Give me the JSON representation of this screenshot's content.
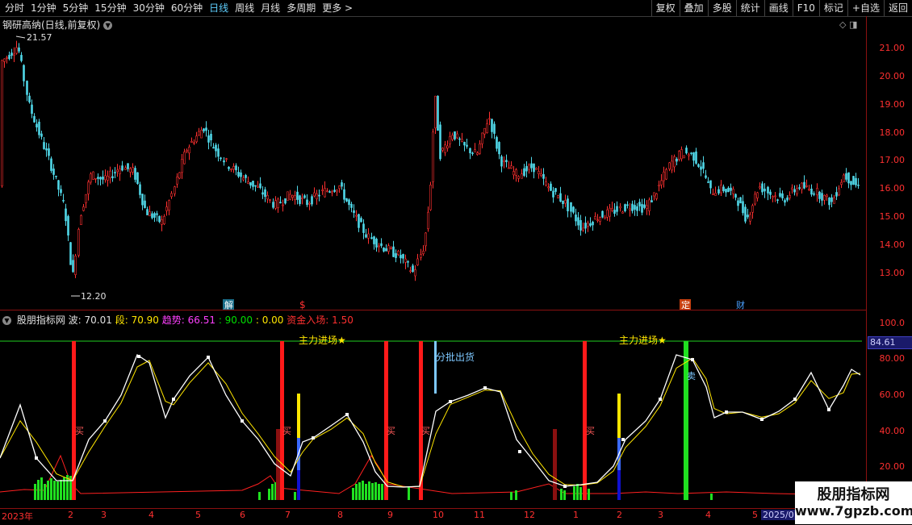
{
  "topbar": {
    "periods": [
      "分时",
      "1分钟",
      "5分钟",
      "15分钟",
      "30分钟",
      "60分钟",
      "日线",
      "周线",
      "月线",
      "多周期",
      "更多 >"
    ],
    "active_period": "日线",
    "actions": [
      "复权",
      "叠加",
      "多股",
      "统计",
      "画线",
      "F10",
      "标记",
      "+自选",
      "返回"
    ]
  },
  "main_chart": {
    "title": "钢研高纳(日线,前复权)",
    "high_label": "21.57",
    "low_label": "12.20",
    "y_ticks": [
      "21.00",
      "20.00",
      "19.00",
      "18.00",
      "17.00",
      "16.00",
      "15.00",
      "14.00",
      "13.00"
    ],
    "event_markers": [
      "解",
      "$",
      "定",
      "财"
    ],
    "colors": {
      "up": "#ff3030",
      "down": "#50d8e8"
    }
  },
  "indicator": {
    "name": "股朋指标网",
    "wave_label": "波: 70.01",
    "segment_label": "段: 70.90",
    "trend_label": "趋势: 66.51",
    "level_label": ": 90.00",
    "zero_label": ": 0.00",
    "capital_label": "资金入场: 1.50",
    "y_ticks": [
      "100.0",
      "80.00",
      "60.00",
      "40.00",
      "20.00"
    ],
    "current_value": "84.61",
    "annotations": [
      "主力进场★",
      "主力进场★",
      "分批出货"
    ],
    "buy_marks": [
      "买",
      "买",
      "买",
      "买",
      "买"
    ],
    "sell_marks": [
      "卖"
    ]
  },
  "dates": [
    "2023年",
    "2",
    "3",
    "4",
    "5",
    "6",
    "7",
    "8",
    "9",
    "10",
    "11",
    "12",
    "1",
    "2",
    "3",
    "4",
    "5",
    "2025/0"
  ],
  "watermark": {
    "line1": "股朋指标网",
    "line2": "www.7gpzb.com"
  }
}
